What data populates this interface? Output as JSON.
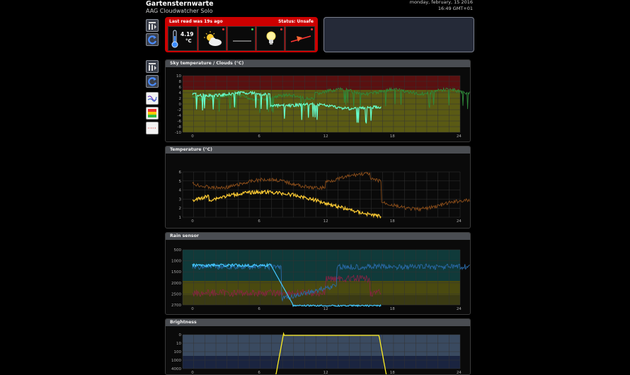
{
  "header": {
    "title": "Gartensternwarte",
    "subtitle": "AAG Cloudwatcher Solo",
    "date": "monday, february, 15 2016",
    "time": "16:49 GMT+01"
  },
  "status": {
    "last_read": "Last read was 19s ago",
    "safety": "Status: Unsafe",
    "temperature": "4.19",
    "temperature_unit": "°C"
  },
  "panels": {
    "sky": "Sky temperature / Clouds (°C)",
    "temperature": "Temperature (°C)",
    "rain": "Rain sensor",
    "brightness": "Brightness"
  },
  "axes": {
    "x_ticks": [
      "0",
      "6",
      "12",
      "18",
      "24"
    ],
    "sky_y": [
      "10",
      "8",
      "6",
      "4",
      "2",
      "0",
      "-2",
      "-4",
      "-6",
      "-8",
      "-10"
    ],
    "temp_y": [
      "6",
      "5",
      "4",
      "3",
      "2",
      "1"
    ],
    "rain_y": [
      "500",
      "1000",
      "1500",
      "2000",
      "2500",
      "2700"
    ],
    "bright_y": [
      "0",
      "10",
      "100",
      "1000",
      "4000"
    ]
  },
  "colors": {
    "unsafe": "#cc0000",
    "sky_current": "#66ffcc",
    "sky_previous": "#2f8a3a",
    "temp_current": "#ffcc33",
    "temp_previous": "#8a4d1a",
    "rain_current": "#44c8ff",
    "rain_previous": "#2a6aa8",
    "brightness": "#ffee22"
  },
  "icons": {
    "sidebar": [
      "chart-mode-icon",
      "refresh-icon",
      "chart-mode-icon",
      "refresh-icon",
      "lines-toggle-icon",
      "thresholds-icon",
      "dotted-lines-icon"
    ],
    "status": [
      "thermometer-icon",
      "partly-cloudy-icon",
      "rain-none-icon",
      "bulb-icon",
      "wind-icon"
    ]
  }
}
